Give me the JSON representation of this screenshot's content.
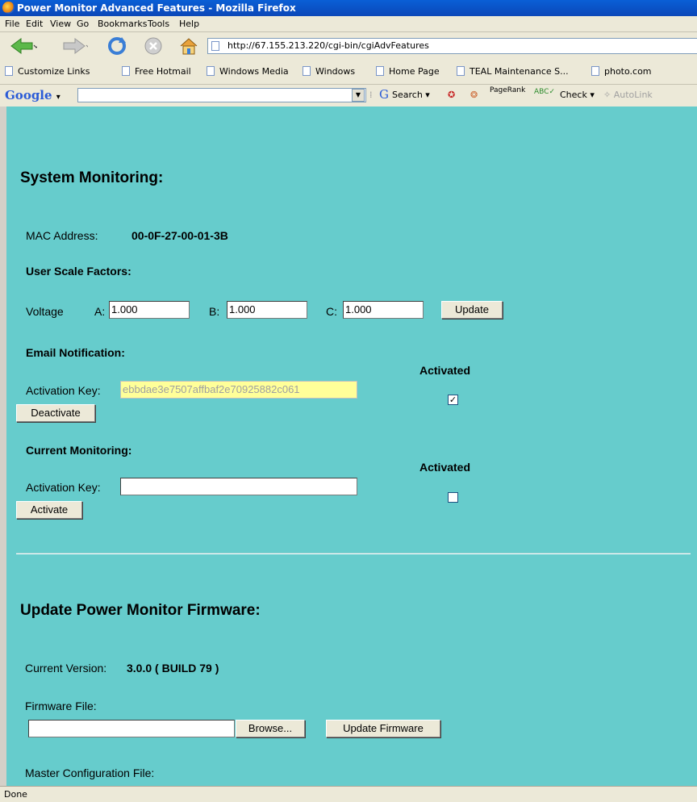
{
  "window": {
    "title": "Power Monitor Advanced Features - Mozilla Firefox"
  },
  "menu": [
    "File",
    "Edit",
    "View",
    "Go",
    "Bookmarks",
    "Tools",
    "Help"
  ],
  "address": {
    "url": "http://67.155.213.220/cgi-bin/cgiAdvFeatures"
  },
  "bookmarks": [
    "Customize Links",
    "Free Hotmail",
    "Windows Media",
    "Windows",
    "Home Page",
    "TEAL Maintenance S...",
    "photo.com"
  ],
  "googlebar": {
    "logo": "Google",
    "search": "Search",
    "pagerank": "PageRank",
    "check": "Check",
    "autolink": "AutoLink"
  },
  "system": {
    "heading": "System Monitoring:",
    "mac_label": "MAC Address:",
    "mac_value": "00-0F-27-00-01-3B",
    "scale_heading": "User Scale Factors:",
    "voltage_label": "Voltage",
    "a_label": "A:",
    "a_value": "1.000",
    "b_label": "B:",
    "b_value": "1.000",
    "c_label": "C:",
    "c_value": "1.000",
    "update_label": "Update"
  },
  "email": {
    "heading": "Email Notification:",
    "activated_label": "Activated",
    "key_label": "Activation Key:",
    "key_value": "ebbdae3e7507affbaf2e70925882c061",
    "checked": true,
    "button_label": "Deactivate"
  },
  "current": {
    "heading": "Current Monitoring:",
    "activated_label": "Activated",
    "key_label": "Activation Key:",
    "key_value": "",
    "checked": false,
    "button_label": "Activate"
  },
  "firmware": {
    "heading": "Update Power Monitor Firmware:",
    "version_label": "Current Version:",
    "version_value": "3.0.0 ( BUILD 79 )",
    "file_label": "Firmware File:",
    "browse_label": "Browse...",
    "update_label": "Update Firmware",
    "master_label": "Master Configuration File:"
  },
  "status": "Done"
}
